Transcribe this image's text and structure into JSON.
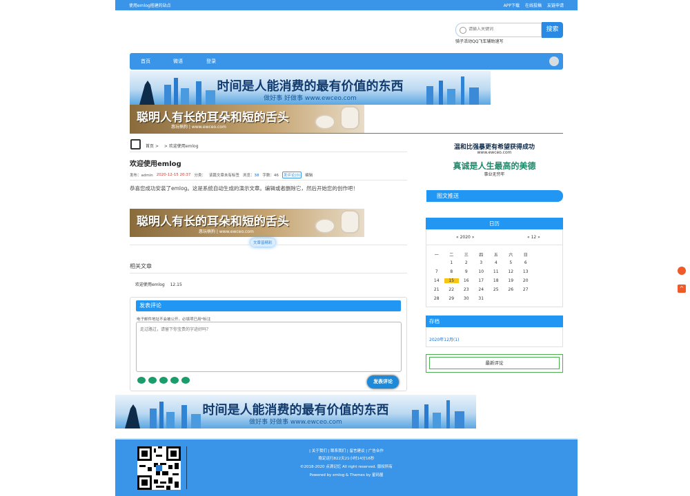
{
  "topbar": {
    "site_note": "使用emlog搭建的站点",
    "links": [
      "APP下载",
      "在线投稿",
      "友链申请"
    ]
  },
  "header": {
    "logo_text": "",
    "search_placeholder": "请输入关键词",
    "search_button": "搜索",
    "hot_words": "骑子活动QQ飞车辅助速写"
  },
  "nav": {
    "items": [
      "首页",
      "微语",
      "登录"
    ]
  },
  "banners": {
    "blue_main": "时间是人能消费的最有价值的东西",
    "blue_sub": "做好事 好做事  www.ewceo.com",
    "brown_main": "聪明人有长的耳朵和短的舌头",
    "brown_sub": "惠玩楠狗 | www.ewceo.com",
    "side_line1": "温和比强暴更有希望获得成功",
    "side_line1_sub": "www.ewceo.com",
    "side_line2": "真诚是人生最高的美德",
    "side_line2_sub": "事业无穷年"
  },
  "article": {
    "breadcrumb_home": "首页",
    "breadcrumb_sep1": ">",
    "breadcrumb_sep2": ">",
    "breadcrumb_current": "欢迎使用emlog",
    "title": "欢迎使用emlog",
    "meta": {
      "author_label": "发布：",
      "author": "admin",
      "date": "2020-12-15 20:37",
      "category_label": "分类：",
      "tags": "该篇文章未有标签",
      "views_label": "浏览：",
      "views": "38",
      "words_label": "字数：",
      "words": "46",
      "comment_badge": "发评论(0)",
      "edit": "编辑"
    },
    "body": "恭喜您成功安装了emlog。这是系统自动生成的演示文章。编辑或者删除它，然后开始您的创作吧！",
    "subscribe_label": "文章皆精彩"
  },
  "related": {
    "title": "相关文章",
    "items": [
      {
        "title": "欢迎使用emlog",
        "date": "12.15"
      }
    ]
  },
  "comment": {
    "header": "发表评论",
    "note": "电子邮件地址不会被公开。必填项已用*标注",
    "placeholder": "走过路过，请留下你宝贵的字迹好吗？",
    "submit": "发表评论"
  },
  "sidebar": {
    "featured_tab": "图文推送",
    "calendar": {
      "title": "日历",
      "year_nav": "« 2020 »",
      "month_nav": "« 12 »",
      "weekdays": [
        "一",
        "二",
        "三",
        "四",
        "五",
        "六",
        "日"
      ],
      "weeks": [
        [
          "",
          "1",
          "2",
          "3",
          "4",
          "5",
          "6"
        ],
        [
          "7",
          "8",
          "9",
          "10",
          "11",
          "12",
          "13"
        ],
        [
          "14",
          "15",
          "16",
          "17",
          "18",
          "19",
          "20"
        ],
        [
          "21",
          "22",
          "23",
          "24",
          "25",
          "26",
          "27"
        ],
        [
          "28",
          "29",
          "30",
          "31",
          "",
          "",
          ""
        ]
      ],
      "today": "15"
    },
    "archive": {
      "title": "存档",
      "items": [
        "2020年12月(1)"
      ]
    },
    "latest_comments": "最新评论"
  },
  "footer": {
    "links": "| 关于我们 | 联系我们 | 留言建议 | 广告合作",
    "uptime": "稳定运行822天21小时14分16秒",
    "copyright": "©2018-2020 点滴记忆 All right reserved. 版权所有",
    "powered": "Powered by emlog & Themes by 星码屋"
  },
  "colors": {
    "primary": "#3a95e8",
    "accent_red": "#d2322d",
    "float_orange": "#f05a28",
    "today_highlight": "#f5c518"
  }
}
